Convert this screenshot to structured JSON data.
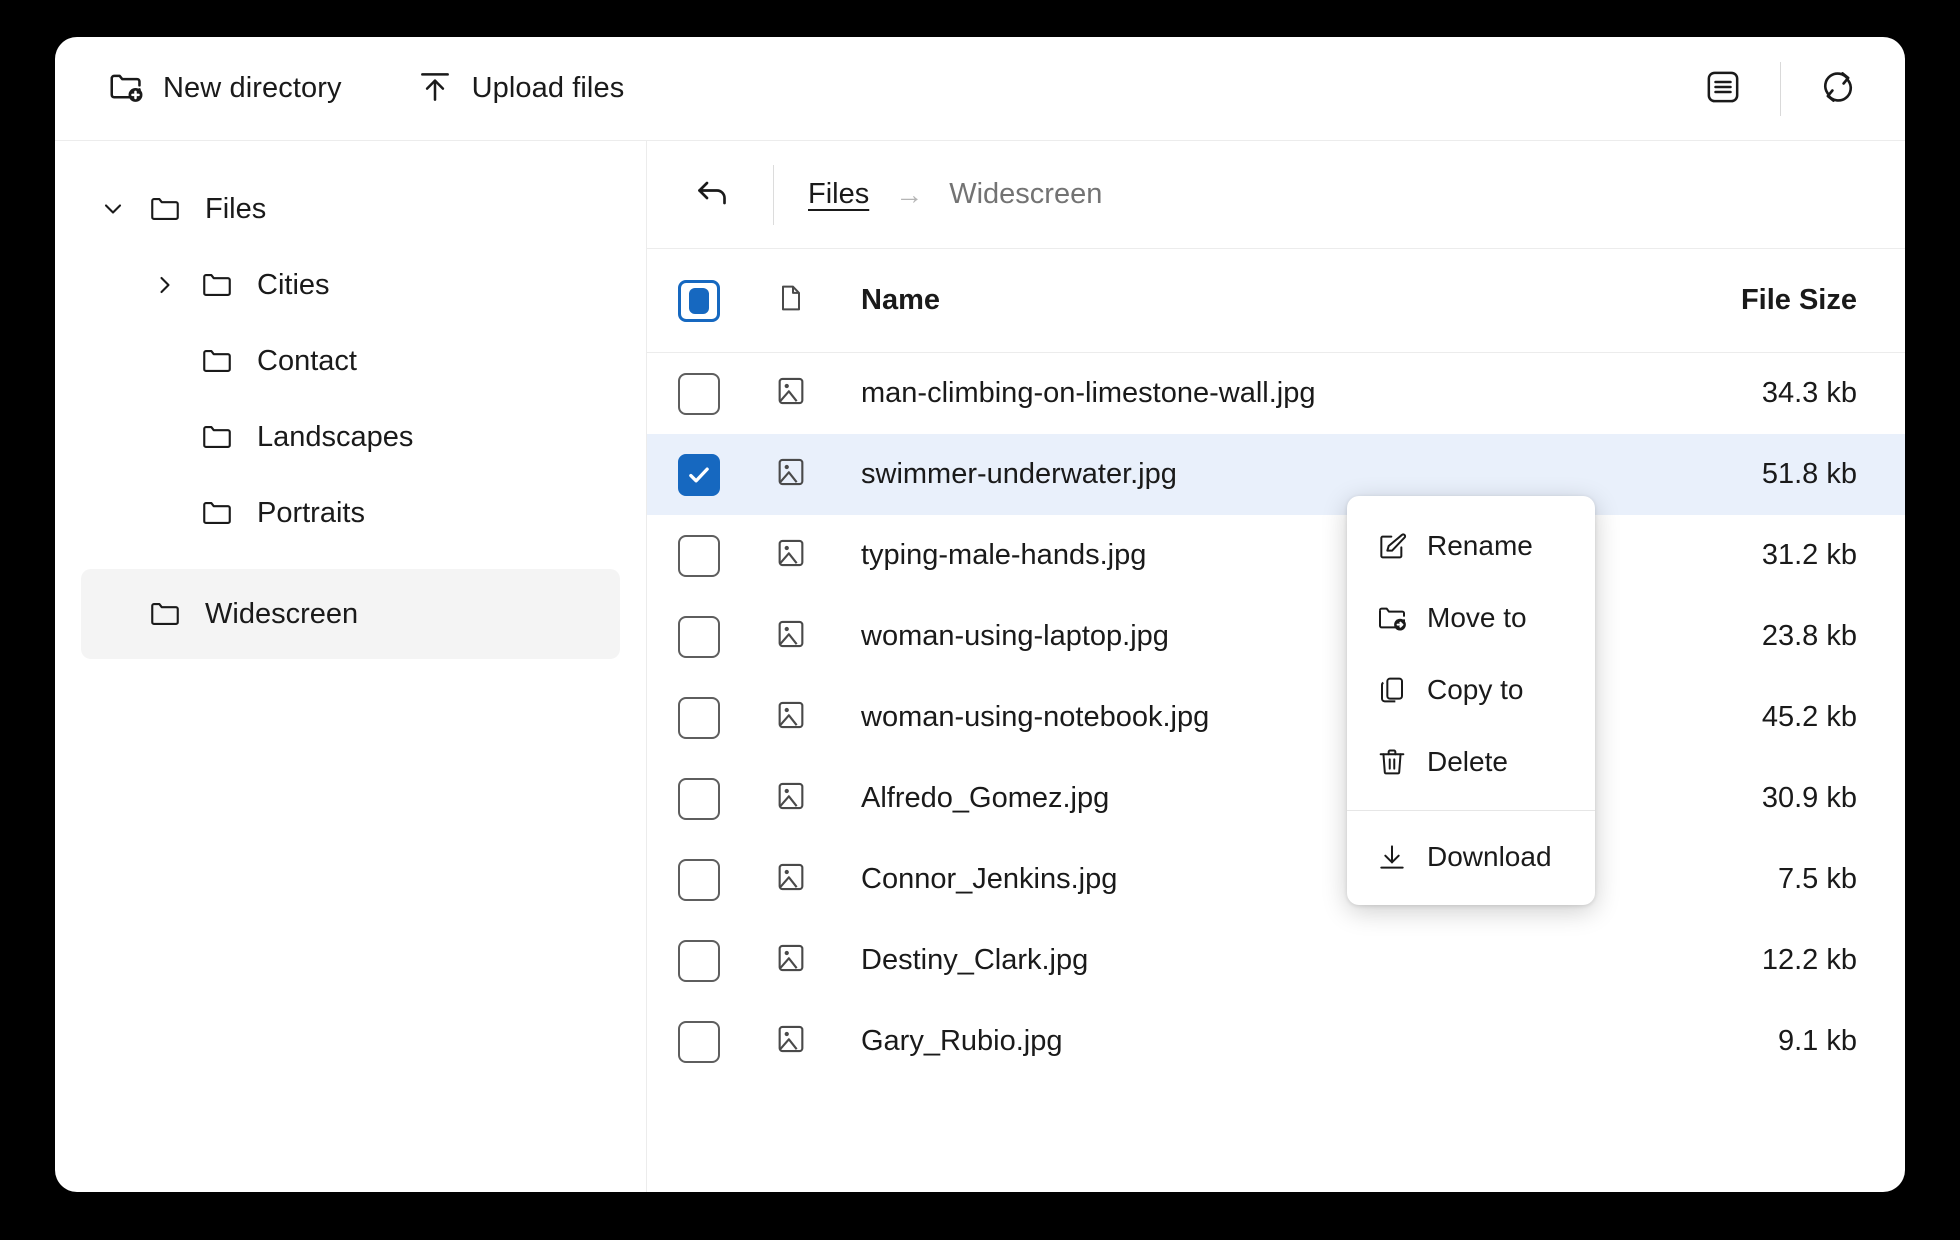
{
  "toolbar": {
    "new_directory_label": "New directory",
    "new_directory_icon": "folder-plus-icon",
    "upload_files_label": "Upload files",
    "upload_files_icon": "upload-arrow-icon",
    "list_view_icon": "list-view-icon",
    "refresh_icon": "refresh-icon"
  },
  "sidebar": {
    "items": [
      {
        "label": "Files",
        "level": 0,
        "expander": "chevron-down",
        "selected": false
      },
      {
        "label": "Cities",
        "level": 1,
        "expander": "chevron-right",
        "selected": false
      },
      {
        "label": "Contact",
        "level": 1,
        "expander": "none",
        "selected": false
      },
      {
        "label": "Landscapes",
        "level": 1,
        "expander": "none",
        "selected": false
      },
      {
        "label": "Portraits",
        "level": 1,
        "expander": "none",
        "selected": false
      },
      {
        "label": "Widescreen",
        "level": 0,
        "expander": "none",
        "selected": true
      }
    ]
  },
  "breadcrumb": {
    "back_icon": "back-arrow-icon",
    "root_label": "Files",
    "separator": "→",
    "current_label": "Widescreen"
  },
  "table": {
    "select_all_state": "indeterminate",
    "file_type_icon": "document-icon",
    "header_name": "Name",
    "header_size": "File Size",
    "rows": [
      {
        "name": "man-climbing-on-limestone-wall.jpg",
        "size": "34.3 kb",
        "selected": false
      },
      {
        "name": "swimmer-underwater.jpg",
        "size": "51.8 kb",
        "selected": true
      },
      {
        "name": "typing-male-hands.jpg",
        "size": "31.2 kb",
        "selected": false
      },
      {
        "name": "woman-using-laptop.jpg",
        "size": "23.8 kb",
        "selected": false
      },
      {
        "name": "woman-using-notebook.jpg",
        "size": "45.2 kb",
        "selected": false
      },
      {
        "name": "Alfredo_Gomez.jpg",
        "size": "30.9 kb",
        "selected": false
      },
      {
        "name": "Connor_Jenkins.jpg",
        "size": "7.5 kb",
        "selected": false
      },
      {
        "name": "Destiny_Clark.jpg",
        "size": "12.2 kb",
        "selected": false
      },
      {
        "name": "Gary_Rubio.jpg",
        "size": "9.1 kb",
        "selected": false
      }
    ]
  },
  "context_menu": {
    "items": [
      {
        "label": "Rename",
        "icon": "edit-pencil-icon"
      },
      {
        "label": "Move to",
        "icon": "folder-arrow-icon"
      },
      {
        "label": "Copy to",
        "icon": "copy-icon"
      },
      {
        "label": "Delete",
        "icon": "trash-icon"
      },
      {
        "label": "Download",
        "icon": "download-icon"
      }
    ],
    "separator_before": "Download"
  },
  "colors": {
    "accent_blue": "#1668c0",
    "selected_row_bg": "#e9f0fb",
    "sidebar_selected_bg": "#f4f4f4",
    "text": "#1a1a1a",
    "muted_text": "#737373"
  }
}
